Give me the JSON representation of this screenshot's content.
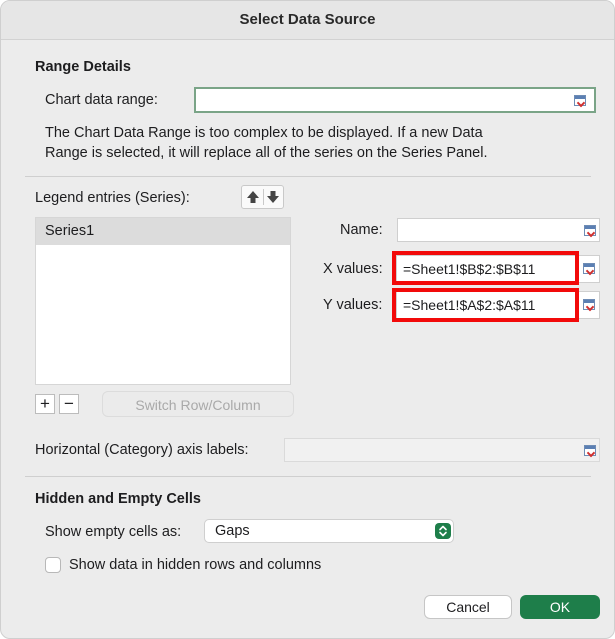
{
  "title": "Select Data Source",
  "range_details": {
    "heading": "Range Details",
    "chart_data_range_label": "Chart data range:",
    "chart_data_range_value": "",
    "info_text_line1": "The Chart Data Range is too complex to be displayed. If a new Data",
    "info_text_line2": "Range is selected, it will replace all of the series on the Series Panel."
  },
  "series_panel": {
    "legend_label": "Legend entries (Series):",
    "move_up_icon": "up-arrow-icon",
    "move_down_icon": "down-arrow-icon",
    "series": [
      "Series1"
    ],
    "add_label": "+",
    "remove_label": "−",
    "switch_label": "Switch Row/Column",
    "name_label": "Name:",
    "name_value": "",
    "x_label": "X values:",
    "x_value": "=Sheet1!$B$2:$B$11",
    "y_label": "Y values:",
    "y_value": "=Sheet1!$A$2:$A$11",
    "axis_label": "Horizontal (Category) axis labels:",
    "axis_value": ""
  },
  "hidden_empty": {
    "heading": "Hidden and Empty Cells",
    "show_empty_label": "Show empty cells as:",
    "show_empty_value": "Gaps",
    "show_hidden_label": "Show data in hidden rows and columns",
    "show_hidden_checked": false
  },
  "buttons": {
    "cancel": "Cancel",
    "ok": "OK"
  },
  "colors": {
    "accent": "#1e7e4a",
    "highlight": "#f20a0a",
    "range_border": "#7aa487"
  }
}
